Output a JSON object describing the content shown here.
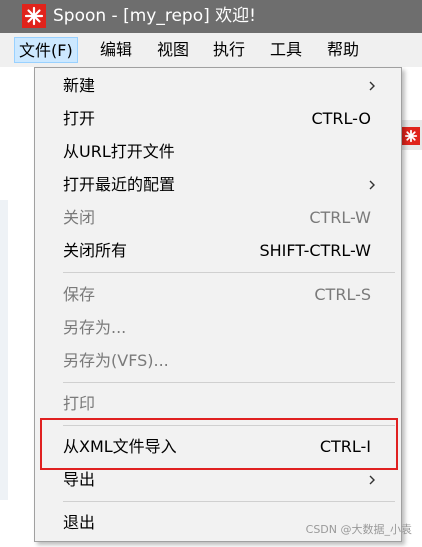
{
  "window": {
    "title": "Spoon - [my_repo] 欢迎!",
    "icon": "spoon-app-icon",
    "titlebar_color": "#6e6e6e"
  },
  "menubar": {
    "items": [
      {
        "label": "文件(F)",
        "active": true
      },
      {
        "label": "编辑"
      },
      {
        "label": "视图"
      },
      {
        "label": "执行"
      },
      {
        "label": "工具"
      },
      {
        "label": "帮助"
      }
    ]
  },
  "file_menu": {
    "items": [
      {
        "label": "新建",
        "shortcut": "",
        "submenu": true,
        "enabled": true
      },
      {
        "label": "打开",
        "shortcut": "CTRL-O",
        "submenu": false,
        "enabled": true
      },
      {
        "label": "从URL打开文件",
        "shortcut": "",
        "submenu": false,
        "enabled": true
      },
      {
        "label": "打开最近的配置",
        "shortcut": "",
        "submenu": true,
        "enabled": true
      },
      {
        "label": "关闭",
        "shortcut": "CTRL-W",
        "submenu": false,
        "enabled": false
      },
      {
        "label": "关闭所有",
        "shortcut": "SHIFT-CTRL-W",
        "submenu": false,
        "enabled": true
      },
      {
        "label": "保存",
        "shortcut": "CTRL-S",
        "submenu": false,
        "enabled": false
      },
      {
        "label": "另存为...",
        "shortcut": "",
        "submenu": false,
        "enabled": false
      },
      {
        "label": "另存为(VFS)...",
        "shortcut": "",
        "submenu": false,
        "enabled": false
      },
      {
        "label": "打印",
        "shortcut": "",
        "submenu": false,
        "enabled": false
      },
      {
        "label": "从XML文件导入",
        "shortcut": "CTRL-I",
        "submenu": false,
        "enabled": true,
        "highlighted": true
      },
      {
        "label": "导出",
        "shortcut": "",
        "submenu": true,
        "enabled": true
      },
      {
        "label": "退出",
        "shortcut": "",
        "submenu": false,
        "enabled": true
      }
    ]
  },
  "annotation": {
    "highlight_color": "#e02020"
  },
  "watermark": {
    "text": "CSDN @大数据_小袁"
  },
  "colors": {
    "accent_red": "#e0231b",
    "menu_bg": "#f2f2f2",
    "menubar_active_bg": "#cce8ff",
    "disabled_text": "#7a7a7a"
  }
}
